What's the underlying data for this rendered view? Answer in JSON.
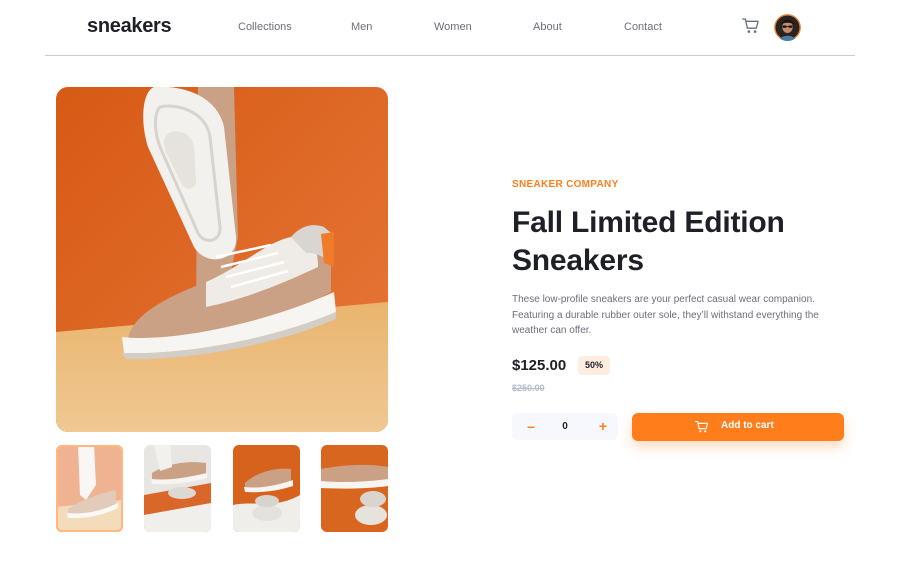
{
  "brand": {
    "logo_text": "sneakers",
    "accent_color": "#ff7e1b",
    "text_color": "#1d2026",
    "muted_color": "#69707d"
  },
  "nav": {
    "items": [
      {
        "label": "Collections"
      },
      {
        "label": "Men"
      },
      {
        "label": "Women"
      },
      {
        "label": "About"
      },
      {
        "label": "Contact"
      }
    ],
    "cart_icon": "cart-icon",
    "avatar": "user-avatar"
  },
  "gallery": {
    "main_image": "white-and-tan-sneakers-on-orange-background",
    "thumbnails": [
      {
        "image": "sneaker-thumbnail-1",
        "selected": true
      },
      {
        "image": "sneaker-thumbnail-2",
        "selected": false
      },
      {
        "image": "sneaker-thumbnail-3",
        "selected": false
      },
      {
        "image": "sneaker-thumbnail-4",
        "selected": false
      }
    ]
  },
  "product": {
    "company": "SNEAKER COMPANY",
    "title": "Fall Limited Edition Sneakers",
    "description": "These low-profile sneakers are your perfect casual wear companion. Featuring a durable rubber outer sole, they’ll withstand everything the weather can offer.",
    "price": "$125.00",
    "discount": "50%",
    "original_price": "$250.00"
  },
  "cart_controls": {
    "minus_label": "–",
    "quantity": "0",
    "plus_label": "+",
    "add_label": "Add to cart",
    "add_icon": "cart-icon"
  }
}
